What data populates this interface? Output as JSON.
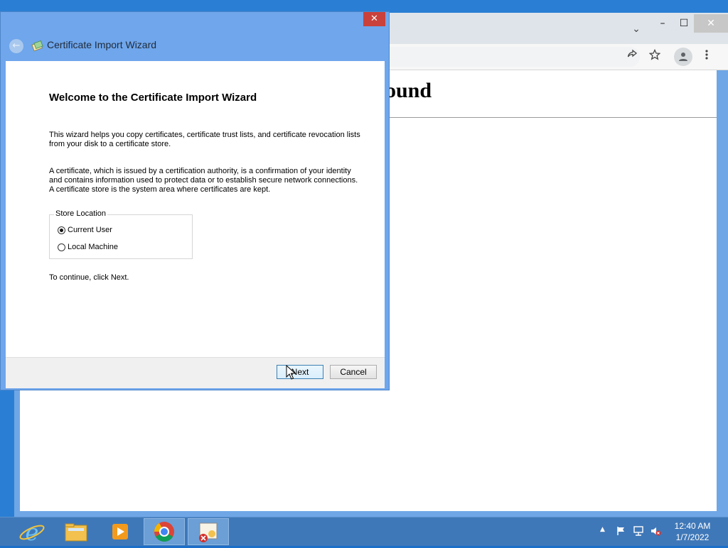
{
  "browser": {
    "page_heading": "ound",
    "tab_search_icon": "chevron-down-icon",
    "window_controls": {
      "minimize": "–",
      "maximize": "☐",
      "close": "✕"
    },
    "toolbar_icons": [
      "share-icon",
      "star-icon",
      "profile-icon",
      "kebab-menu-icon"
    ]
  },
  "dialog": {
    "title": "Certificate Import Wizard",
    "heading": "Welcome to the Certificate Import Wizard",
    "paragraph1": "This wizard helps you copy certificates, certificate trust lists, and certificate revocation lists from your disk to a certificate store.",
    "paragraph2": "A certificate, which is issued by a certification authority, is a confirmation of your identity and contains information used to protect data or to establish secure network connections. A certificate store is the system area where certificates are kept.",
    "store_location": {
      "label": "Store Location",
      "options": [
        {
          "label": "Current User",
          "selected": true
        },
        {
          "label": "Local Machine",
          "selected": false
        }
      ]
    },
    "continue_text": "To continue, click Next.",
    "next_label": "Next",
    "cancel_label": "Cancel",
    "close_glyph": "✕",
    "back_glyph": "←"
  },
  "taskbar": {
    "apps": [
      "internet-explorer-icon",
      "file-explorer-icon",
      "media-player-icon",
      "chrome-icon",
      "certificate-icon"
    ],
    "active_app": "certificate-icon",
    "tray_chevron": "▲",
    "clock_time": "12:40 AM",
    "clock_date": "1/7/2022"
  },
  "colors": {
    "desktop": "#2a7fd4",
    "dialog_frame": "#6fa6ec",
    "close_red": "#c9413a",
    "taskbar": "#3f78b8"
  }
}
